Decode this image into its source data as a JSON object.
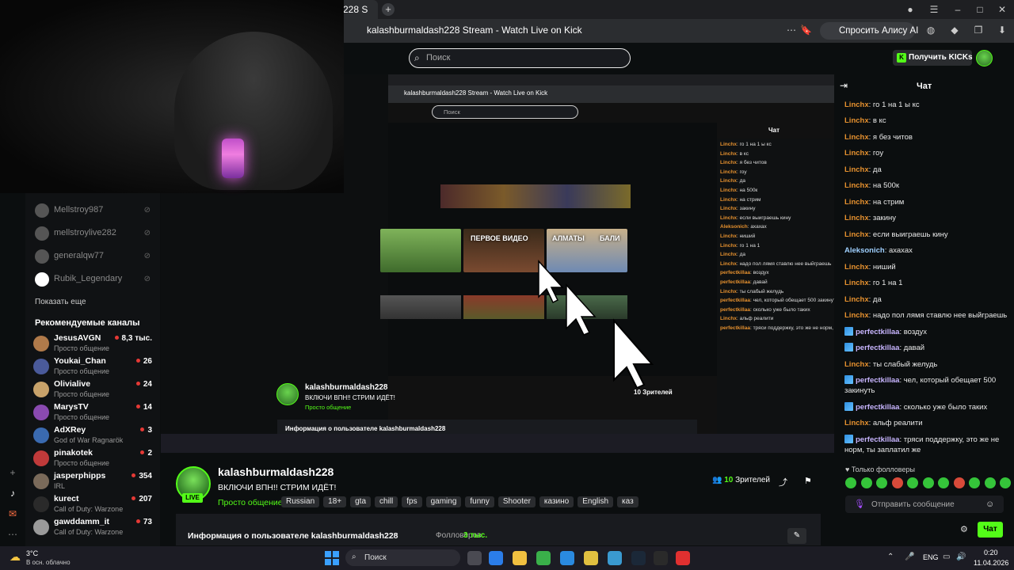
{
  "browser": {
    "tab_title": "228 S",
    "page_title": "kalashburmaldash228 Stream - Watch Live on Kick",
    "alisa_button": "Спросить Алису AI"
  },
  "header": {
    "search_placeholder": "Поиск",
    "kicks_button": "Получить KICKs"
  },
  "sidebar": {
    "favorites": [
      {
        "name": "Mellstroy987"
      },
      {
        "name": "mellstroylive282"
      },
      {
        "name": "generalqw77"
      },
      {
        "name": "Rubik_Legendary"
      }
    ],
    "show_more": "Показать еще",
    "recommended_title": "Рекомендуемые каналы",
    "recommended": [
      {
        "name": "JesusAVGN",
        "category": "Просто общение",
        "viewers": "8,3 тыс.",
        "color": "#b07a4a"
      },
      {
        "name": "Youkai_Chan",
        "category": "Просто общение",
        "viewers": "26",
        "color": "#4a5a9a"
      },
      {
        "name": "Olivialive",
        "category": "Просто общение",
        "viewers": "24",
        "color": "#c8a26a"
      },
      {
        "name": "MarysTV",
        "category": "Просто общение",
        "viewers": "14",
        "color": "#8a4ab0"
      },
      {
        "name": "AdXRey",
        "category": "God of War Ragnarök",
        "viewers": "3",
        "color": "#3a6ab0"
      },
      {
        "name": "pinakotek",
        "category": "Просто общение",
        "viewers": "2",
        "color": "#c03a3a"
      },
      {
        "name": "jasperphipps",
        "category": "IRL",
        "viewers": "354",
        "color": "#7a6a5a"
      },
      {
        "name": "kurect",
        "category": "Call of Duty: Warzone",
        "viewers": "207",
        "color": "#2a2a2a"
      },
      {
        "name": "gawddamm_it",
        "category": "Call of Duty: Warzone",
        "viewers": "73",
        "color": "#9a9a9a"
      }
    ]
  },
  "video": {
    "thumb_titles": [
      "ПЕРВОЕ ВИДЕО",
      "АЛМАТЫ",
      "БАЛИ"
    ],
    "nested_chat_lines": [
      {
        "user": "Linchx",
        "text": "го 1 на 1 ы кс"
      },
      {
        "user": "Linchx",
        "text": "в кс"
      },
      {
        "user": "Linchx",
        "text": "я без читов"
      },
      {
        "user": "Linchx",
        "text": "гоу"
      },
      {
        "user": "Linchx",
        "text": "да"
      },
      {
        "user": "Linchx",
        "text": "на 500к"
      },
      {
        "user": "Linchx",
        "text": "на стрим"
      },
      {
        "user": "Linchx",
        "text": "закину"
      },
      {
        "user": "Linchx",
        "text": "если выиграешь кину"
      },
      {
        "user": "Aleksonich",
        "text": "ахахах"
      },
      {
        "user": "Linchx",
        "text": "ниший"
      },
      {
        "user": "Linchx",
        "text": "го 1 на 1"
      },
      {
        "user": "Linchx",
        "text": "да"
      },
      {
        "user": "Linchx",
        "text": "надо пол лямя ставлю нее выйграешь"
      },
      {
        "user": "perfectkillaa",
        "text": "воздух"
      },
      {
        "user": "perfectkillaa",
        "text": "давай"
      },
      {
        "user": "Linchx",
        "text": "ты слабый желудь"
      },
      {
        "user": "perfectkillaa",
        "text": "чел, который обещает 500 закинуть"
      },
      {
        "user": "perfectkillaa",
        "text": "сколько уже было таких"
      },
      {
        "user": "Linchx",
        "text": "альф реалити"
      },
      {
        "user": "perfectkillaa",
        "text": "тряси поддержку, это же не норм, ты заплатил же"
      }
    ]
  },
  "channel": {
    "name": "kalashburmaldash228",
    "live_badge": "LIVE",
    "title": "ВКЛЮЧИ ВПН!! СТРИМ ИДЁТ!",
    "category": "Просто общение",
    "tags": [
      "Russian",
      "18+",
      "gta",
      "chill",
      "fps",
      "gaming",
      "funny",
      "Shooter",
      "казино",
      "English",
      "каз"
    ],
    "viewers_count": "10",
    "viewers_label": "Зрителей",
    "info_label": "Информация о пользователе kalashburmaldash228",
    "followers_label": "Фолловеров:",
    "followers_count": "3 тыс."
  },
  "chat": {
    "title": "Чат",
    "messages": [
      {
        "user": "Linchx",
        "color": "#e6912f",
        "text": "го 1 на 1 ы кс",
        "badge": false
      },
      {
        "user": "Linchx",
        "color": "#e6912f",
        "text": "в кс",
        "badge": false
      },
      {
        "user": "Linchx",
        "color": "#e6912f",
        "text": "я без читов",
        "badge": false
      },
      {
        "user": "Linchx",
        "color": "#e6912f",
        "text": "гоу",
        "badge": false
      },
      {
        "user": "Linchx",
        "color": "#e6912f",
        "text": "да",
        "badge": false
      },
      {
        "user": "Linchx",
        "color": "#e6912f",
        "text": "на 500к",
        "badge": false
      },
      {
        "user": "Linchx",
        "color": "#e6912f",
        "text": "на стрим",
        "badge": false
      },
      {
        "user": "Linchx",
        "color": "#e6912f",
        "text": "закину",
        "badge": false
      },
      {
        "user": "Linchx",
        "color": "#e6912f",
        "text": "если выиграешь кину",
        "badge": false
      },
      {
        "user": "Aleksonich",
        "color": "#9fd0ff",
        "text": "ахахах",
        "badge": false
      },
      {
        "user": "Linchx",
        "color": "#e6912f",
        "text": "ниший",
        "badge": false
      },
      {
        "user": "Linchx",
        "color": "#e6912f",
        "text": "го 1 на 1",
        "badge": false
      },
      {
        "user": "Linchx",
        "color": "#e6912f",
        "text": "да",
        "badge": false
      },
      {
        "user": "Linchx",
        "color": "#e6912f",
        "text": "надо пол лямя ставлю нее выйграешь",
        "badge": false
      },
      {
        "user": "perfectkillaa",
        "color": "#c8b5ff",
        "text": "воздух",
        "badge": true
      },
      {
        "user": "perfectkillaa",
        "color": "#c8b5ff",
        "text": "давай",
        "badge": true
      },
      {
        "user": "Linchx",
        "color": "#e6912f",
        "text": "ты слабый желудь",
        "badge": false
      },
      {
        "user": "perfectkillaa",
        "color": "#c8b5ff",
        "text": "чел, который обещает 500 закинуть",
        "badge": true
      },
      {
        "user": "perfectkillaa",
        "color": "#c8b5ff",
        "text": "сколько уже было таких",
        "badge": true
      },
      {
        "user": "Linchx",
        "color": "#e6912f",
        "text": "альф реалити",
        "badge": false
      },
      {
        "user": "perfectkillaa",
        "color": "#c8b5ff",
        "text": "тряси поддержку, это же не норм, ты заплатил же",
        "badge": true
      }
    ],
    "followers_only": "Только фолловеры",
    "input_placeholder": "Отправить сообщение",
    "send_label": "Чат"
  },
  "taskbar": {
    "weather_temp": "3°C",
    "weather_desc": "В осн. облачно",
    "search_label": "Поиск",
    "lang": "ENG",
    "time": "0:20",
    "date": "11.04.2026"
  },
  "colors": {
    "accent": "#53fc18",
    "background": "#0b0e0f",
    "panel": "#191b1f"
  }
}
